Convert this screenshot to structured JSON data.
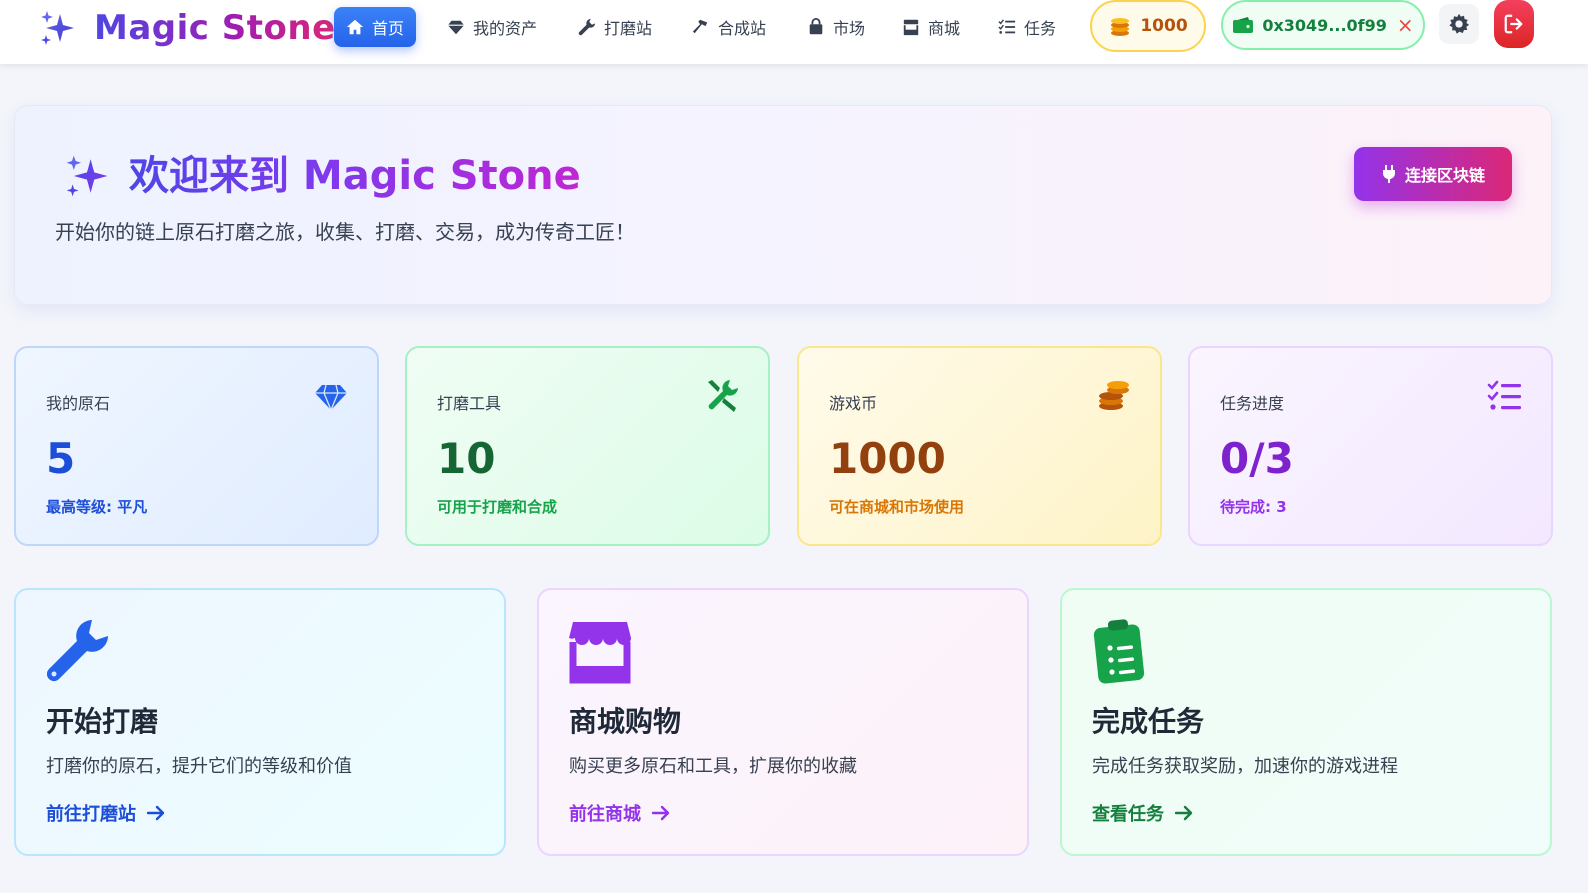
{
  "brand": {
    "name": "Magic Stone"
  },
  "nav": {
    "items": [
      {
        "label": "首页",
        "icon": "home-icon",
        "active": true
      },
      {
        "label": "我的资产",
        "icon": "gem-icon"
      },
      {
        "label": "打磨站",
        "icon": "wrench-icon"
      },
      {
        "label": "合成站",
        "icon": "hammer-icon"
      },
      {
        "label": "市场",
        "icon": "shopping-bag-icon"
      },
      {
        "label": "商城",
        "icon": "store-icon"
      },
      {
        "label": "任务",
        "icon": "list-check-icon"
      }
    ],
    "coins": "1000",
    "wallet": "0x3049...0f99",
    "wallet_close": "×"
  },
  "hero": {
    "title": "欢迎来到 Magic Stone",
    "subtitle": "开始你的链上原石打磨之旅，收集、打磨、交易，成为传奇工匠！",
    "connect_label": "连接区块链"
  },
  "stats": [
    {
      "label": "我的原石",
      "value": "5",
      "note": "最高等级: 平凡",
      "icon": "gem-icon",
      "color": "#1d4ed8"
    },
    {
      "label": "打磨工具",
      "value": "10",
      "note": "可用于打磨和合成",
      "icon": "tools-icon",
      "color": "#16a34a"
    },
    {
      "label": "游戏币",
      "value": "1000",
      "note": "可在商城和市场使用",
      "icon": "coins-icon",
      "color": "#d97706"
    },
    {
      "label": "任务进度",
      "value": "0/3",
      "note": "待完成: 3",
      "icon": "list-check-icon",
      "color": "#9333ea"
    }
  ],
  "actions": [
    {
      "title": "开始打磨",
      "desc": "打磨你的原石，提升它们的等级和价值",
      "link": "前往打磨站",
      "icon": "wrench-icon"
    },
    {
      "title": "商城购物",
      "desc": "购买更多原石和工具，扩展你的收藏",
      "link": "前往商城",
      "icon": "store-icon"
    },
    {
      "title": "完成任务",
      "desc": "完成任务获取奖励，加速你的游戏进程",
      "link": "查看任务",
      "icon": "clipboard-list-icon"
    }
  ],
  "colors": {
    "primary": "#2563eb",
    "accent_purple": "#9333ea",
    "accent_pink": "#db2777",
    "success": "#16a34a",
    "warning": "#d97706",
    "danger": "#dc2626"
  }
}
